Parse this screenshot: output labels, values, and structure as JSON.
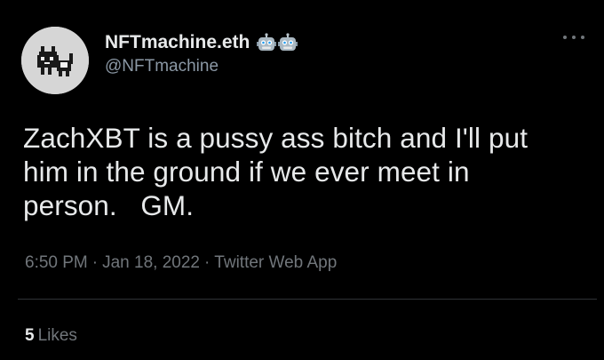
{
  "author": {
    "display_name": "NFTmachine.eth",
    "handle": "@NFTmachine",
    "avatar_icon": "pixel-cat-avatar",
    "name_emojis": [
      "robot-face-icon",
      "robot-face-icon"
    ]
  },
  "tweet": {
    "text": "ZachXBT is a pussy ass bitch and I'll put\nhim in the ground if we ever meet in\nperson.   GM.",
    "time": "6:50 PM",
    "separator": "·",
    "date": "Jan 18, 2022",
    "source": "Twitter Web App"
  },
  "stats": {
    "likes_count": "5",
    "likes_label": "Likes"
  },
  "colors": {
    "background": "#000000",
    "primary_text": "#e7e9ea",
    "secondary_text": "#71767b",
    "divider": "#2f3336"
  }
}
